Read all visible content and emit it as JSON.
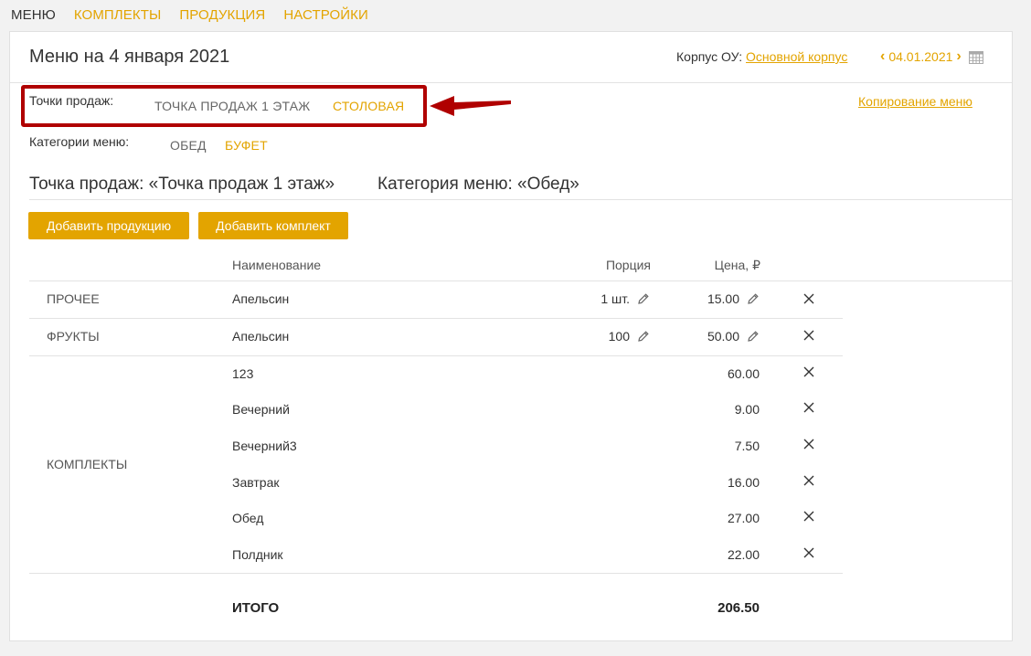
{
  "nav": {
    "menu": "МЕНЮ",
    "kits": "КОМПЛЕКТЫ",
    "products": "ПРОДУКЦИЯ",
    "settings": "НАСТРОЙКИ"
  },
  "header": {
    "title": "Меню на 4 января 2021",
    "korpus_label": "Корпус ОУ:",
    "korpus_value": "Основной корпус",
    "date": "04.01.2021",
    "prev_icon": "chevron-left-icon",
    "next_icon": "chevron-right-icon",
    "calendar_icon": "calendar-icon"
  },
  "sales_points": {
    "label": "Точки продаж:",
    "options": [
      "ТОЧКА ПРОДАЖ 1 ЭТАЖ",
      "СТОЛОВАЯ"
    ]
  },
  "copy_menu": "Копирование меню",
  "categories": {
    "label": "Категории меню:",
    "options": [
      "ОБЕД",
      "БУФЕТ"
    ]
  },
  "section": {
    "point_title": "Точка продаж: «Точка продаж 1 этаж»",
    "category_title": "Категория меню: «Обед»"
  },
  "buttons": {
    "add_product": "Добавить продукцию",
    "add_kit": "Добавить комплект"
  },
  "table": {
    "headers": {
      "name": "Наименование",
      "portion": "Порция",
      "price": "Цена, ₽"
    },
    "groups": [
      {
        "category": "ПРОЧЕЕ",
        "rows": [
          {
            "name": "Апельсин",
            "portion": "1 шт.",
            "price": "15.00"
          }
        ]
      },
      {
        "category": "ФРУКТЫ",
        "rows": [
          {
            "name": "Апельсин",
            "portion": "100",
            "price": "50.00"
          }
        ]
      },
      {
        "category": "КОМПЛЕКТЫ",
        "rows": [
          {
            "name": "123",
            "price": "60.00"
          },
          {
            "name": "Вечерний",
            "price": "9.00"
          },
          {
            "name": "Вечерний3",
            "price": "7.50"
          },
          {
            "name": "Завтрак",
            "price": "16.00"
          },
          {
            "name": "Обед",
            "price": "27.00"
          },
          {
            "name": "Полдник",
            "price": "22.00"
          }
        ]
      }
    ],
    "total_label": "ИТОГО",
    "total_value": "206.50"
  },
  "colors": {
    "accent": "#e3a400",
    "highlight_box": "#b00000"
  },
  "icons": {
    "edit": "pencil-icon",
    "remove": "close-icon",
    "annotation": "arrow-left-icon"
  }
}
